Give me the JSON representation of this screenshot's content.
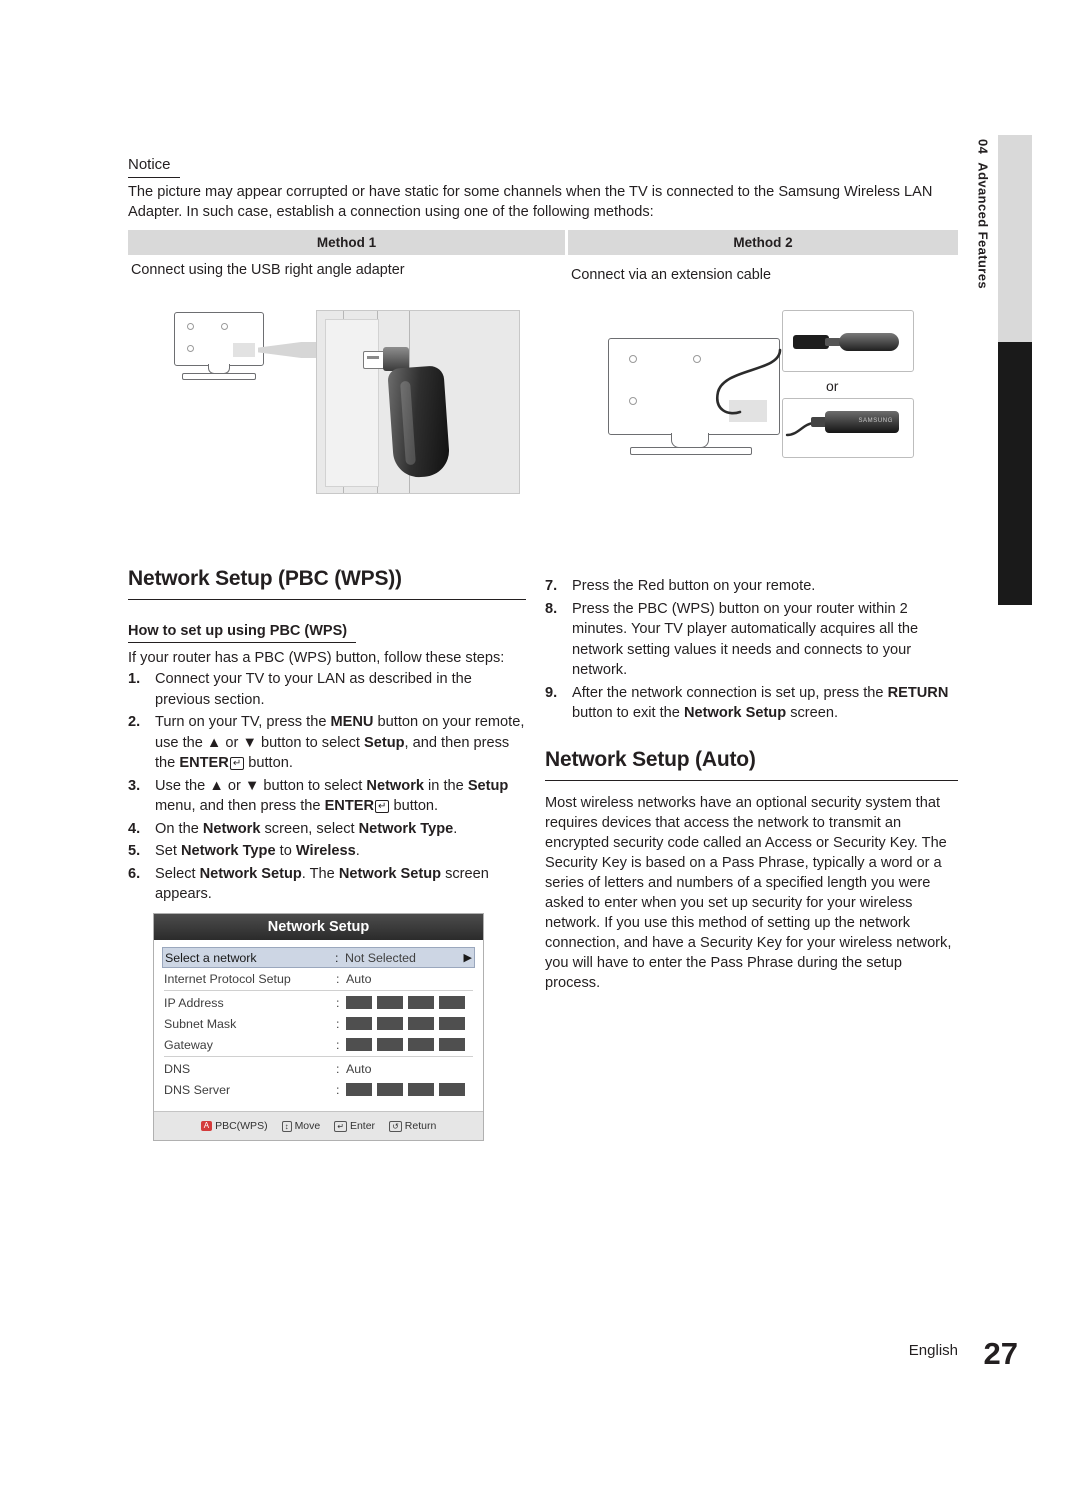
{
  "sidetab": {
    "number": "04",
    "label": "Advanced Features"
  },
  "notice": {
    "title": "Notice",
    "body": "The picture may appear corrupted or have static for some channels when the TV is connected to the Samsung Wireless LAN Adapter. In such case, establish a connection using one of the following methods:"
  },
  "methods": [
    {
      "head": "Method 1",
      "caption": "Connect using the USB right angle adapter"
    },
    {
      "head": "Method 2",
      "caption": "Connect via an extension cable"
    }
  ],
  "illustration": {
    "or_label": "or",
    "brand_label": "SAMSUNG"
  },
  "pbc": {
    "title": "Network Setup (PBC (WPS))",
    "subtitle": "How to set up using PBC (WPS)",
    "intro": "If your router has a PBC (WPS) button, follow these steps:",
    "steps": [
      {
        "num": "1.",
        "html": "Connect your TV to your LAN as described in the previous section."
      },
      {
        "num": "2.",
        "html": "Turn on your TV, press the <b>MENU</b> button on your remote, use the ▲ or ▼ button to select <b>Setup</b>, and then press the <b>ENTER</b><span class=\"key\">↵</span> button."
      },
      {
        "num": "3.",
        "html": "Use the ▲ or ▼ button to select <b>Network</b> in the <b>Setup</b> menu, and then press the <b>ENTER</b><span class=\"key\">↵</span> button."
      },
      {
        "num": "4.",
        "html": "On the <b>Network</b> screen, select <b>Network Type</b>."
      },
      {
        "num": "5.",
        "html": "Set <b>Network Type</b> to <b>Wireless</b>."
      },
      {
        "num": "6.",
        "html": "Select <b>Network Setup</b>. The <b>Network Setup</b> screen appears."
      },
      {
        "num": "7.",
        "html": "Press the Red button on your remote."
      },
      {
        "num": "8.",
        "html": "Press the PBC (WPS) button on your router within 2 minutes. Your TV player automatically acquires all the network setting values it needs and connects to your network."
      },
      {
        "num": "9.",
        "html": "After the network connection is set up, press the <b>RETURN</b> button to exit the <b>Network Setup</b> screen."
      }
    ]
  },
  "osd": {
    "title": "Network Setup",
    "rows": [
      {
        "label": "Select a network",
        "colon": ":",
        "value": "Not Selected",
        "type": "select",
        "arrow": "▶"
      },
      {
        "label": "Internet Protocol Setup",
        "colon": ":",
        "value": "Auto",
        "type": "value"
      },
      {
        "label": "IP Address",
        "colon": ":",
        "type": "boxes",
        "boxes": 4
      },
      {
        "label": "Subnet Mask",
        "colon": ":",
        "type": "boxes",
        "boxes": 4
      },
      {
        "label": "Gateway",
        "colon": ":",
        "type": "boxes",
        "boxes": 4
      },
      {
        "label": "DNS",
        "colon": ":",
        "value": "Auto",
        "type": "value"
      },
      {
        "label": "DNS Server",
        "colon": ":",
        "type": "boxes",
        "boxes": 4
      }
    ],
    "footer": [
      {
        "glyph": "A",
        "label": "PBC(WPS)",
        "kind": "red"
      },
      {
        "glyph": "↕",
        "label": "Move",
        "kind": "plain"
      },
      {
        "glyph": "↵",
        "label": "Enter",
        "kind": "key"
      },
      {
        "glyph": "↺",
        "label": "Return",
        "kind": "plain"
      }
    ]
  },
  "auto": {
    "title": "Network Setup (Auto)",
    "body": "Most wireless networks have an optional security system that requires devices that access the network to transmit an encrypted security code called an Access or Security Key. The Security Key is based on a Pass Phrase, typically a word or a series of letters and numbers of a specified length you were asked to enter when you set up security for your wireless network.  If you use this method of setting up the network connection, and have a Security Key for your wireless network, you will have to enter the Pass Phrase during the setup process."
  },
  "footer": {
    "language": "English",
    "page": "27"
  }
}
